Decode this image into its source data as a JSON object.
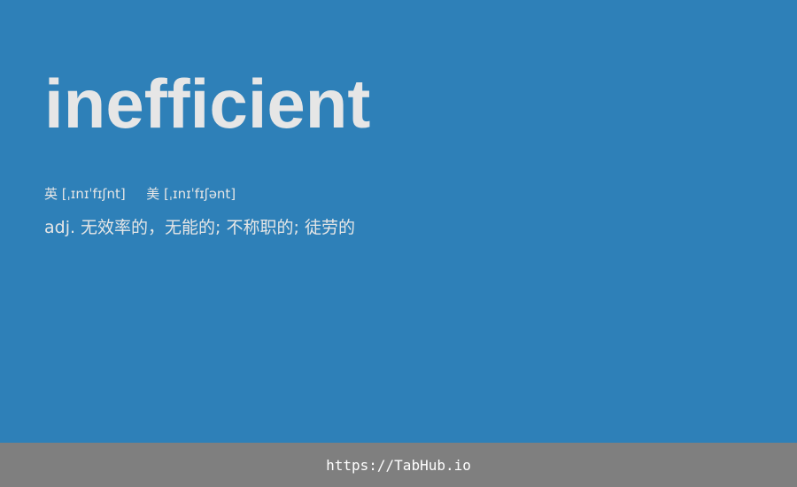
{
  "entry": {
    "word": "inefficient",
    "uk_label": "英",
    "uk_ipa": "[ˌɪnɪˈfɪʃnt]",
    "us_label": "美",
    "us_ipa": "[ˌɪnɪˈfɪʃənt]",
    "definition": "adj. 无效率的，无能的; 不称职的; 徒劳的"
  },
  "footer": {
    "link_text": "https://TabHub.io"
  },
  "colors": {
    "background": "#2e80b8",
    "footer_background": "#7f7f7f",
    "text": "#e6e6e6"
  }
}
